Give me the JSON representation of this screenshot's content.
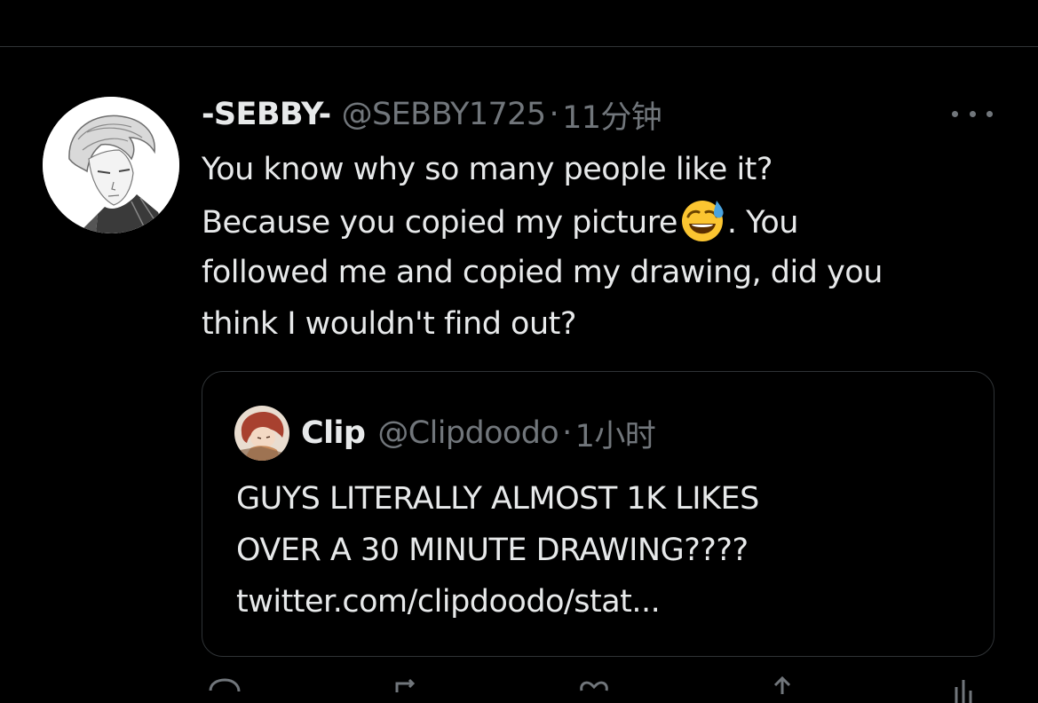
{
  "tweet": {
    "display_name": "-SEBBY-",
    "handle": "@SEBBY1725",
    "separator": "·",
    "time": "11分钟",
    "text_lines": [
      "You know why so many people like it?",
      "Because you copied my picture",
      ". You",
      "followed me and copied my drawing, did you",
      "think I wouldn't find out?"
    ],
    "emoji": "grinning-face-with-sweat-emoji",
    "more_icon": "more-options-icon"
  },
  "quote": {
    "display_name": "Clip",
    "handle": "@Clipdoodo",
    "separator": "·",
    "time": "1小时",
    "text_lines": [
      "GUYS LITERALLY ALMOST 1K LIKES",
      "OVER A 30 MINUTE DRAWING????",
      "twitter.com/clipdoodo/stat..."
    ]
  },
  "actions": {
    "icons": [
      "reply-icon",
      "retweet-icon",
      "like-icon",
      "share-icon"
    ]
  },
  "colors": {
    "background": "#000000",
    "primary_text": "#e7e9ea",
    "secondary_text": "#71767b",
    "border": "#2f3336"
  }
}
